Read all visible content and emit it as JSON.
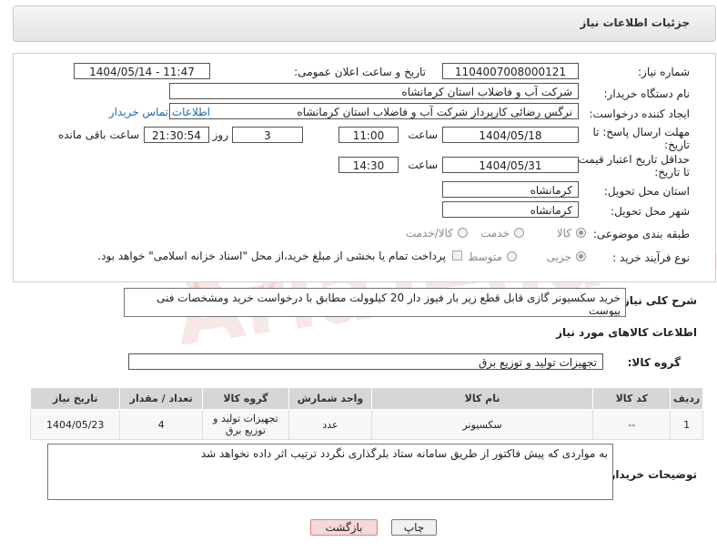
{
  "header": {
    "title": "جزئیات اطلاعات نیاز"
  },
  "form": {
    "need_number_label": "شماره نیاز:",
    "need_number": "1104007008000121",
    "announce_label": "تاریخ و ساعت اعلان عمومی:",
    "announce_value": "1404/05/14 - 11:47",
    "buyer_org_label": "نام دستگاه خریدار:",
    "buyer_org": "شرکت آب و فاضلاب استان کرمانشاه",
    "creator_label": "ایجاد کننده درخواست:",
    "creator": "نرگس رضائی کارپرداز شرکت آب و فاضلاب استان کرمانشاه",
    "contact_link": "اطلاعات تماس خریدار",
    "deadline_label_1": "مهلت ارسال پاسخ: تا",
    "deadline_label_2": "تاریخ:",
    "deadline_date": "1404/05/18",
    "time_label": "ساعت",
    "deadline_time": "11:00",
    "days_value": "3",
    "days_label": "روز و",
    "remaining_time": "21:30:54",
    "remaining_label": "ساعت باقی مانده",
    "price_label_1": "حداقل تاریخ اعتبار قیمت:",
    "price_label_2": "تا تاریخ:",
    "price_date": "1404/05/31",
    "price_time_label": "ساعت",
    "price_time": "14:30",
    "province_label": "استان محل تحویل:",
    "province": "کرمانشاه",
    "city_label": "شهر محل تحویل:",
    "city": "کرمانشاه",
    "category_label": "طبقه بندی موضوعی:",
    "category_options": [
      "کالا",
      "خدمت",
      "کالا/خدمت"
    ],
    "purchase_label": "نوع فرآیند خرید :",
    "purchase_options": [
      "جزیی",
      "متوسط"
    ],
    "payment_note": "پرداخت تمام یا بخشی از مبلغ خرید،از محل \"اسناد خزانه اسلامی\" خواهد بود."
  },
  "description": {
    "label": "شرح کلی نیاز:",
    "value": "خرید سکسیونر گازی قابل قطع زیر بار فیوز دار 20 کیلوولت مطابق با درخواست خرید ومشخصات فنی پیوست"
  },
  "items_section": {
    "title": "اطلاعات کالاهای مورد نیاز",
    "group_label": "گروه کالا:",
    "group_value": "تجهیزات تولید و توزیع برق"
  },
  "table": {
    "headers": [
      "ردیف",
      "کد کالا",
      "نام کالا",
      "واحد شمارش",
      "گروه کالا",
      "تعداد / مقدار",
      "تاریخ نیاز"
    ],
    "rows": [
      [
        "1",
        "--",
        "سکسیونر",
        "عدد",
        "تجهیزات تولید و توزیع برق",
        "4",
        "1404/05/23"
      ]
    ]
  },
  "buyer_notes": {
    "label": "توضیحات خریدار:",
    "value": "به مواردی که پیش فاکتور از طریق سامانه ستاد بلرگذاری نگردد ترتیب اثر داده نخواهد شد"
  },
  "buttons": {
    "print": "چاپ",
    "back": "بازگشت"
  },
  "watermark": "AriaTender.net"
}
